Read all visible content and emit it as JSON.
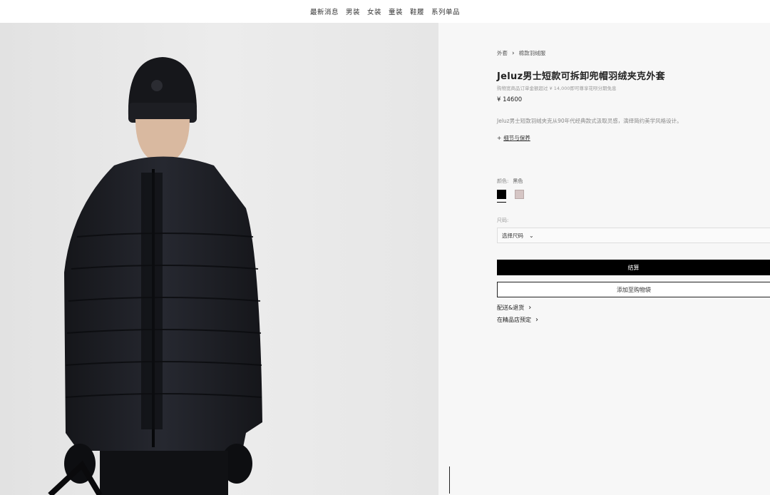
{
  "nav": {
    "items": [
      "最新消息",
      "男装",
      "女装",
      "童装",
      "鞋履",
      "系列单品"
    ]
  },
  "product": {
    "breadcrumb": [
      "外套",
      "棉款羽绒服"
    ],
    "title": "Jeluz男士短款可拆卸兜帽羽绒夹克外套",
    "promo": "购物宽商品订单金额超过 ¥ 14,000即可尊享花呗分期免息",
    "price": "¥ 14600",
    "description": "Jeluz男士短款羽绒夹克从90年代经典款式汲取灵感，演绎简约美学风格设计。",
    "details_link": "细节与保养",
    "color_label": "颜色:",
    "color_value": "黑色",
    "colors": [
      "#000000",
      "#d5c5c4"
    ],
    "size_label": "尺码:",
    "size_placeholder": "选择尺码",
    "checkout_label": "结算",
    "add_to_bag_label": "添加至购物袋",
    "shipping_link": "配送&退货",
    "boutique_link": "在精品店预定"
  },
  "icons": {
    "breadcrumb_separator": "chevron-right-icon",
    "details_plus": "plus-icon",
    "size_dropdown": "chevron-down-icon",
    "link_chevron": "chevron-right-icon"
  }
}
